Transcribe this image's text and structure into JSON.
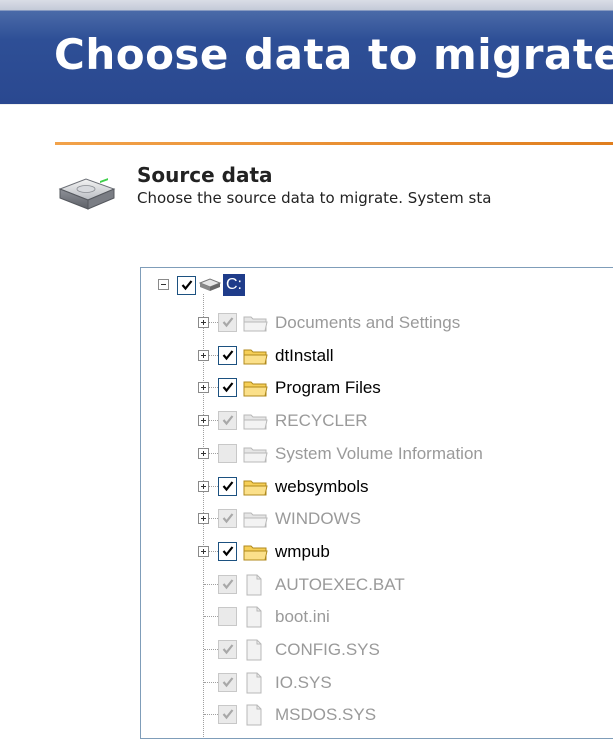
{
  "header": {
    "title": "Choose data to migrate"
  },
  "section": {
    "title": "Source data",
    "description": "Choose the source data to migrate.  System sta",
    "icon": "hard-drive-icon"
  },
  "tree": {
    "root": {
      "label": "C:",
      "checked": true,
      "expanded": true,
      "selected": true,
      "icon": "drive-icon"
    },
    "items": [
      {
        "label": "Documents and Settings",
        "type": "folder",
        "checked": true,
        "enabled": false,
        "expandable": true
      },
      {
        "label": "dtInstall",
        "type": "folder",
        "checked": true,
        "enabled": true,
        "expandable": true
      },
      {
        "label": "Program Files",
        "type": "folder",
        "checked": true,
        "enabled": true,
        "expandable": true
      },
      {
        "label": "RECYCLER",
        "type": "folder",
        "checked": true,
        "enabled": false,
        "expandable": true
      },
      {
        "label": "System Volume Information",
        "type": "folder",
        "checked": false,
        "enabled": false,
        "expandable": true
      },
      {
        "label": "websymbols",
        "type": "folder",
        "checked": true,
        "enabled": true,
        "expandable": true
      },
      {
        "label": "WINDOWS",
        "type": "folder",
        "checked": true,
        "enabled": false,
        "expandable": true
      },
      {
        "label": "wmpub",
        "type": "folder",
        "checked": true,
        "enabled": true,
        "expandable": true
      },
      {
        "label": "AUTOEXEC.BAT",
        "type": "file",
        "checked": true,
        "enabled": false,
        "expandable": false
      },
      {
        "label": "boot.ini",
        "type": "file",
        "checked": false,
        "enabled": false,
        "expandable": false
      },
      {
        "label": "CONFIG.SYS",
        "type": "file",
        "checked": true,
        "enabled": false,
        "expandable": false
      },
      {
        "label": "IO.SYS",
        "type": "file",
        "checked": true,
        "enabled": false,
        "expandable": false
      },
      {
        "label": "MSDOS.SYS",
        "type": "file",
        "checked": true,
        "enabled": false,
        "expandable": false
      }
    ]
  },
  "colors": {
    "header": "#2e4f96",
    "accent_rule": "#e88a2a",
    "selection": "#1f3c8a",
    "disabled_text": "#9a9a9a"
  }
}
